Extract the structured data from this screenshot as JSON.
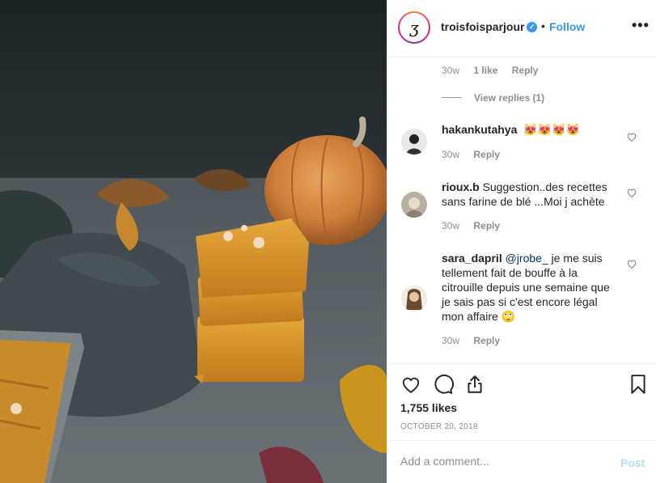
{
  "photo": {
    "alt": ""
  },
  "header": {
    "avatar_letter": "ʒ",
    "username": "troisfoisparjour",
    "verified_mark": "✓",
    "dot": "•",
    "follow_label": "Follow",
    "more_label": "•••"
  },
  "comments": {
    "prev_meta": {
      "age": "30w",
      "likes": "1 like",
      "reply": "Reply"
    },
    "view_replies": "View replies (1)",
    "items": [
      {
        "user": "hakankutahya",
        "text": "😻😻😻😻",
        "age": "30w",
        "reply": "Reply"
      },
      {
        "user": "rioux.b",
        "text": "Suggestion..des recettes sans farine de blé ...Moi j achète",
        "age": "30w",
        "reply": "Reply"
      },
      {
        "user": "sara_dapril",
        "mention": "@jrobe_",
        "text": "je me suis tellement fait de bouffe à la citrouille depuis une semaine que je sais pas si c'est encore légal mon affaire 🙄",
        "age": "30w",
        "reply": "Reply"
      }
    ]
  },
  "actions": {
    "likes": "1,755 likes",
    "date": "OCTOBER 20, 2018"
  },
  "add_comment": {
    "placeholder": "Add a comment...",
    "post_label": "Post"
  },
  "colors": {
    "link_blue": "#3897f0",
    "post_disabled": "#b2dffc",
    "muted": "#8e8e8e"
  }
}
